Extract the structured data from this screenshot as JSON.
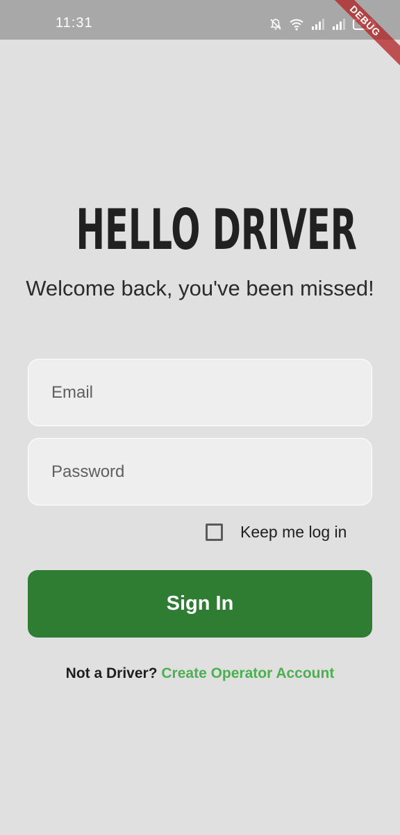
{
  "status_bar": {
    "time": "11:31",
    "battery_level": "92",
    "icons": [
      "mute-bell-icon",
      "wifi-icon",
      "signal-icon",
      "signal-icon",
      "battery-icon"
    ]
  },
  "debug_banner": "DEBUG",
  "header": {
    "title": "HELLO DRIVER",
    "subtitle": "Welcome back, you've been missed!"
  },
  "form": {
    "email_placeholder": "Email",
    "password_placeholder": "Password",
    "keep_logged_in_label": "Keep me log in",
    "keep_logged_in_checked": false,
    "sign_in_label": "Sign In"
  },
  "footer": {
    "prefix": "Not a Driver?",
    "link": "Create Operator Account"
  },
  "colors": {
    "background": "#e0e0e0",
    "status_bar": "#a8a8a8",
    "primary_button": "#2e7d32",
    "link": "#4caf50",
    "field_background": "#eeeeee"
  }
}
